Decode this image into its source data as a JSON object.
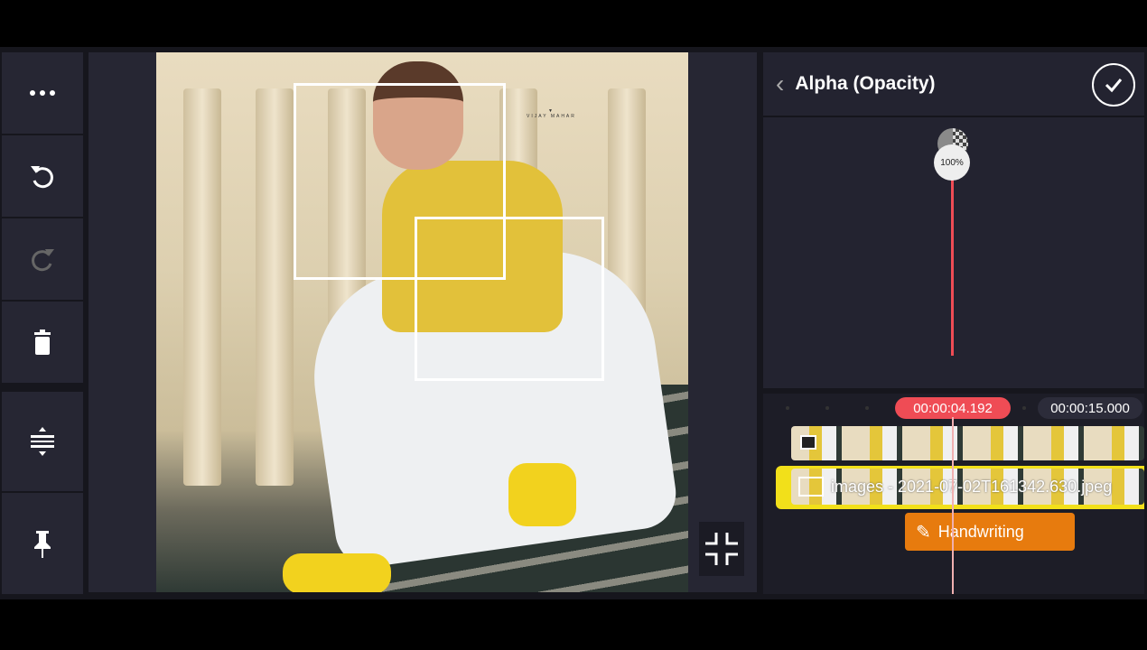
{
  "toolbar": {
    "items": [
      {
        "icon": "more-icon"
      },
      {
        "icon": "undo-icon"
      },
      {
        "icon": "redo-icon"
      },
      {
        "icon": "delete-icon"
      },
      {
        "icon": "split-layers-icon"
      },
      {
        "icon": "pin-icon"
      }
    ]
  },
  "preview": {
    "watermark": "VIJAY MAHAR"
  },
  "panel": {
    "title": "Alpha (Opacity)",
    "opacity_label": "100%",
    "opacity_value": 100
  },
  "timeline": {
    "current_time": "00:00:04.192",
    "total_time": "00:00:15.000",
    "clip_name": "images - 2021-07-02T161342.630.jpeg",
    "handwriting_label": "Handwriting"
  },
  "colors": {
    "accent": "#ef4c55",
    "handwriting": "#e77b0e",
    "selected_clip": "#f2e01a"
  }
}
